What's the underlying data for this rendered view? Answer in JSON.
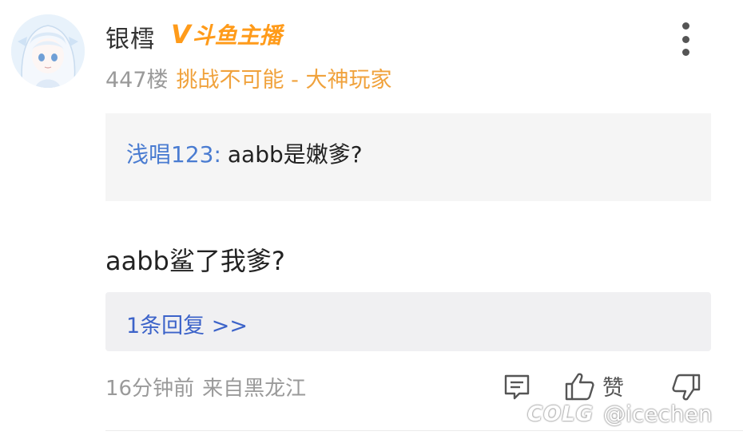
{
  "post": {
    "username": "银樰",
    "badge": {
      "v_mark": "V",
      "text": "斗鱼主播",
      "color": "#ff9b1a"
    },
    "floor": "447楼",
    "title": "挑战不可能 - 大神玩家",
    "quote": {
      "name": "浅唱123:",
      "text": "aabb是嫩爹?"
    },
    "comment": "aabb鲨了我爹?",
    "replies_label": "1条回复 >>",
    "time": "16分钟前",
    "location": "来自黑龙江",
    "like_label": "赞"
  },
  "icons": {
    "avatar": "avatar-anime-girl",
    "more": "more-vertical-icon",
    "comment": "comment-icon",
    "like": "thumbs-up-icon",
    "dislike": "thumbs-down-icon"
  },
  "watermark": {
    "logo": "COLG",
    "handle": "@icechen"
  },
  "colors": {
    "accent_blue": "#4a7cd1",
    "reply_blue": "#3c63c9",
    "title_orange": "#f0a23c",
    "meta_gray": "#9a9a9a"
  }
}
